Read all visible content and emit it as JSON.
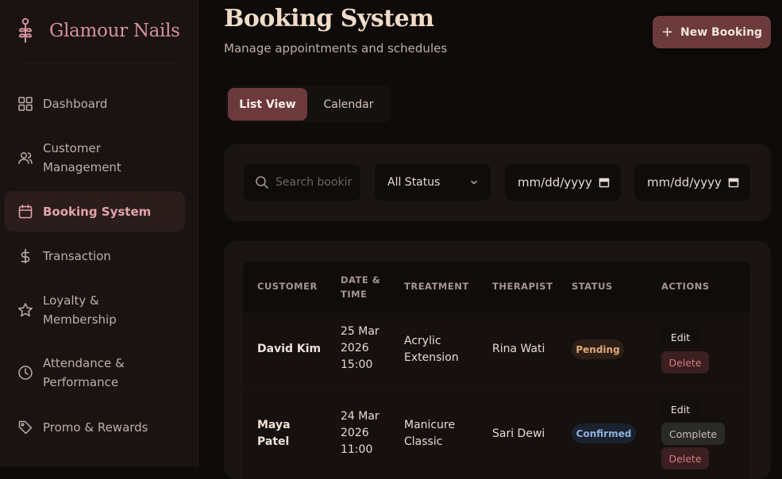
{
  "brand": {
    "name": "Glamour Nails"
  },
  "nav": [
    {
      "label": "Dashboard",
      "icon": "dashboard-icon"
    },
    {
      "label": "Customer Management",
      "icon": "users-icon"
    },
    {
      "label": "Booking System",
      "icon": "calendar-icon",
      "active": true
    },
    {
      "label": "Transaction",
      "icon": "dollar-icon"
    },
    {
      "label": "Loyalty & Membership",
      "icon": "star-icon"
    },
    {
      "label": "Attendance & Performance",
      "icon": "clock-icon"
    },
    {
      "label": "Promo & Rewards",
      "icon": "tag-icon"
    }
  ],
  "header": {
    "title": "Booking System",
    "subtitle": "Manage appointments and schedules",
    "new_button": "New Booking"
  },
  "tabs": [
    {
      "label": "List View",
      "active": true
    },
    {
      "label": "Calendar",
      "active": false
    }
  ],
  "filters": {
    "search_placeholder": "Search bookir",
    "status_value": "All Status",
    "date_from": "mm/dd/yyyy",
    "date_to": "mm/dd/yyyy"
  },
  "table": {
    "columns": [
      "CUSTOMER",
      "DATE & TIME",
      "TREATMENT",
      "THERAPIST",
      "STATUS",
      "ACTIONS"
    ],
    "rows": [
      {
        "customer": "David Kim",
        "date": "25 Mar 2026 15:00",
        "treatment": "Acrylic Extension",
        "therapist": "Rina Wati",
        "status": "Pending",
        "actions": [
          "Edit",
          "Delete"
        ]
      },
      {
        "customer": "Maya Patel",
        "date": "24 Mar 2026 11:00",
        "treatment": "Manicure Classic",
        "therapist": "Sari Dewi",
        "status": "Confirmed",
        "actions": [
          "Edit",
          "Complete",
          "Delete"
        ]
      }
    ]
  },
  "colors": {
    "accent": "#6c3a3c",
    "brand": "#d5929a",
    "sidebar_bg": "#1a1312",
    "page_bg": "#0e0b0a",
    "pending": "#e5a976",
    "confirmed": "#8fb0dc"
  }
}
